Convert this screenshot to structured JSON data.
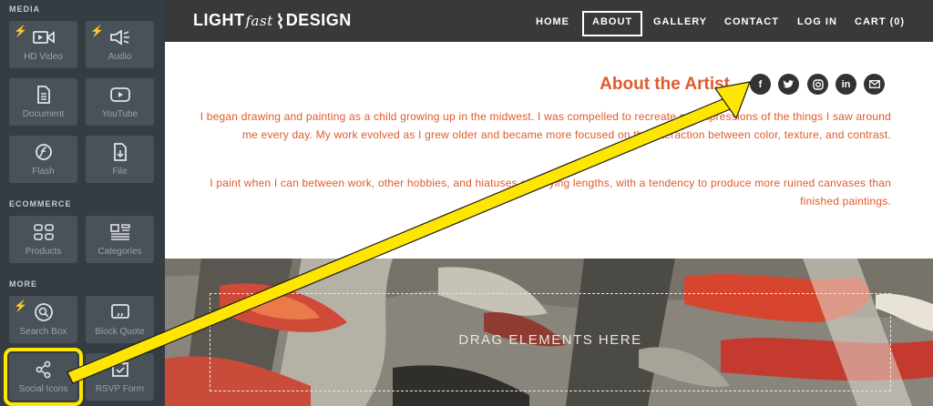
{
  "sidebar": {
    "media_label": "MEDIA",
    "ecommerce_label": "ECOMMERCE",
    "more_label": "MORE",
    "items": [
      {
        "label": "HD Video",
        "icon": "video-camera-icon",
        "bolt": true
      },
      {
        "label": "Audio",
        "icon": "speaker-icon",
        "bolt": true
      },
      {
        "label": "Document",
        "icon": "document-icon",
        "bolt": false
      },
      {
        "label": "YouTube",
        "icon": "play-icon",
        "bolt": false
      },
      {
        "label": "Flash",
        "icon": "flash-icon",
        "bolt": false
      },
      {
        "label": "File",
        "icon": "file-icon",
        "bolt": false
      },
      {
        "label": "Products",
        "icon": "products-grid-icon",
        "bolt": false
      },
      {
        "label": "Categories",
        "icon": "categories-icon",
        "bolt": false
      },
      {
        "label": "Search Box",
        "icon": "search-icon",
        "bolt": true
      },
      {
        "label": "Block Quote",
        "icon": "quote-icon",
        "bolt": false
      },
      {
        "label": "Social Icons",
        "icon": "share-icon",
        "bolt": false
      },
      {
        "label": "RSVP Form",
        "icon": "rsvp-icon",
        "bolt": false
      }
    ]
  },
  "brand": {
    "part1": "LIGHT",
    "part2": "fast",
    "part3": "DESIGN"
  },
  "nav": {
    "home": "HOME",
    "about": "ABOUT",
    "gallery": "GALLERY",
    "contact": "CONTACT",
    "login": "LOG IN",
    "cart": "CART (0)"
  },
  "content": {
    "heading": "About the Artist",
    "paragraph1": "I began drawing and painting as a child growing up in the midwest. I was compelled to recreate my impressions of the things I saw around me every day. My work evolved as I grew older and became more focused on the interaction between color, texture, and contrast.",
    "paragraph2": "I paint when I can between work, other hobbies, and hiatuses of varying lengths, with a tendency to produce more ruined canvases than finished paintings.",
    "social_icons": [
      "facebook-icon",
      "twitter-icon",
      "instagram-icon",
      "linkedin-icon",
      "email-icon"
    ]
  },
  "banner": {
    "dropzone_text": "DRAG ELEMENTS HERE"
  },
  "colors": {
    "accent": "#e05a2a",
    "highlight": "#ffe600",
    "sidebar": "#353c42",
    "navbar": "#3a3939"
  }
}
